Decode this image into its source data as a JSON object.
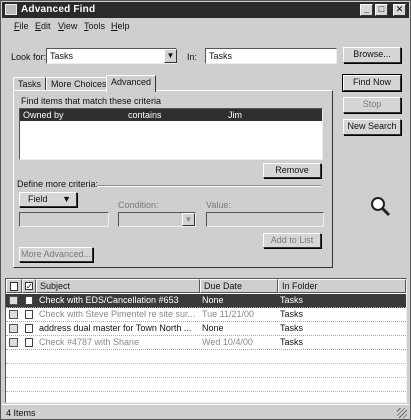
{
  "window": {
    "title": "Advanced Find",
    "controls": {
      "minimize": "_",
      "maximize": "□",
      "close": "✕"
    }
  },
  "menu": [
    "File",
    "Edit",
    "View",
    "Tools",
    "Help"
  ],
  "search": {
    "look_for_label": "Look for:",
    "look_for_value": "Tasks",
    "in_label": "In:",
    "in_value": "Tasks",
    "browse": "Browse..."
  },
  "actions": {
    "find_now": "Find Now",
    "stop": "Stop",
    "new_search": "New Search"
  },
  "tabs": [
    "Tasks",
    "More Choices",
    "Advanced"
  ],
  "advanced": {
    "find_items_label": "Find items that match these criteria",
    "criteria": [
      {
        "field": "Owned by",
        "condition": "contains",
        "value": "Jim"
      }
    ],
    "remove": "Remove",
    "define_more": "Define more criteria:",
    "field_button": "Field",
    "condition_label": "Condition:",
    "value_label": "Value:",
    "add_to_list": "Add to List",
    "more_advanced": "More Advanced..."
  },
  "results": {
    "headers": {
      "subject": "Subject",
      "due_date": "Due Date",
      "in_folder": "In Folder"
    },
    "rows": [
      {
        "subject": "Check with EDS/Cancellation #653",
        "due_date": "None",
        "in_folder": "Tasks",
        "checked": false,
        "style": "selected"
      },
      {
        "subject": "Check with Steve Pimentel re site sur...",
        "due_date": "Tue 11/21/00",
        "in_folder": "Tasks",
        "checked": false,
        "style": "dim"
      },
      {
        "subject": "address dual master for Town North ...",
        "due_date": "None",
        "in_folder": "Tasks",
        "checked": false,
        "style": "normal"
      },
      {
        "subject": "Check #4787 with Shane",
        "due_date": "Wed 10/4/00",
        "in_folder": "Tasks",
        "checked": false,
        "style": "dim"
      }
    ]
  },
  "status": {
    "items": "4 Items"
  }
}
